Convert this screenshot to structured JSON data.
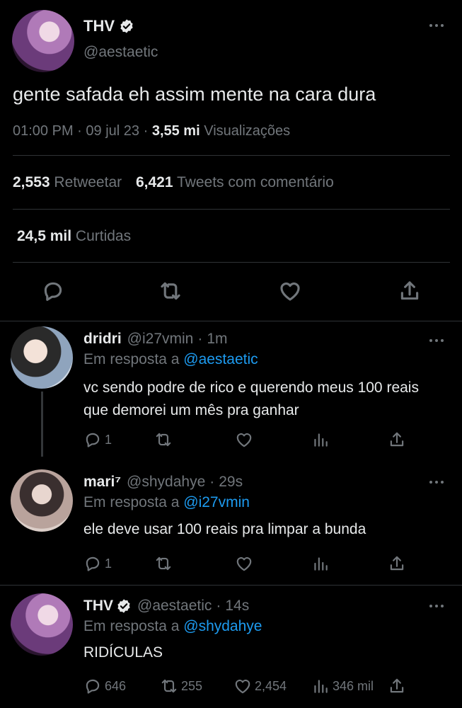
{
  "main_tweet": {
    "display_name": "THV",
    "handle": "@aestaetic",
    "text": "gente safada eh assim mente na cara dura",
    "time": "01:00 PM",
    "date": "09 jul 23",
    "views_count": "3,55 mi",
    "views_label": "Visualizações",
    "retweets_count": "2,553",
    "retweets_label": "Retweetar",
    "quotes_count": "6,421",
    "quotes_label": "Tweets com comentário",
    "likes_count": "24,5 mil",
    "likes_label": "Curtidas"
  },
  "replies": [
    {
      "display_name": "dridri",
      "handle": "@i27vmin",
      "time": "1m",
      "reply_prefix": "Em resposta a",
      "reply_to": "@aestaetic",
      "text": "vc sendo podre de rico e querendo meus 100 reais que demorei um mês pra ganhar",
      "reply_count": "1",
      "retweet_count": "",
      "like_count": "",
      "view_count": ""
    },
    {
      "display_name": "mari⁷",
      "handle": "@shydahye",
      "time": "29s",
      "reply_prefix": "Em resposta a",
      "reply_to": "@i27vmin",
      "text": "ele deve usar 100 reais pra limpar a bunda",
      "reply_count": "1",
      "retweet_count": "",
      "like_count": "",
      "view_count": ""
    },
    {
      "display_name": "THV",
      "handle": "@aestaetic",
      "time": "14s",
      "reply_prefix": "Em resposta a",
      "reply_to": "@shydahye",
      "text": "RIDÍCULAS",
      "reply_count": "646",
      "retweet_count": "255",
      "like_count": "2,454",
      "view_count": "346 mil"
    }
  ],
  "separators": {
    "dot": "·"
  },
  "colors": {
    "background": "#000000",
    "text": "#e7e9ea",
    "muted": "#71767b",
    "link": "#1d9bf0",
    "divider": "#2f3336"
  },
  "icons": [
    "verified-badge-icon",
    "more-icon",
    "reply-icon",
    "retweet-icon",
    "like-icon",
    "share-icon",
    "views-icon"
  ]
}
